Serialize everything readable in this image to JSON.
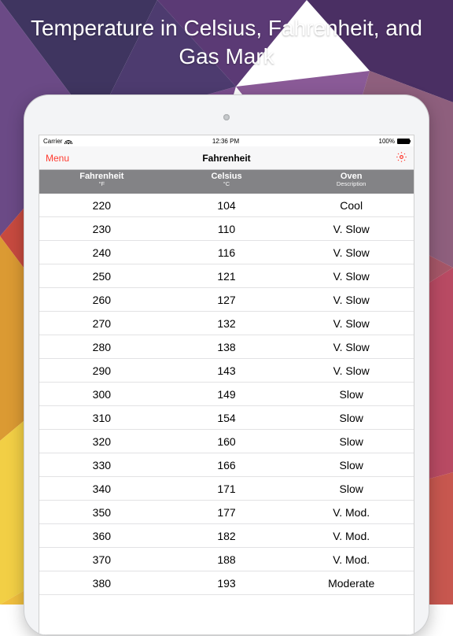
{
  "promo": {
    "title": "Temperature in Celsius, Fahrenheit, and Gas Mark"
  },
  "statusbar": {
    "carrier": "Carrier",
    "time": "12:36 PM",
    "battery": "100%"
  },
  "navbar": {
    "menu": "Menu",
    "title": "Fahrenheit",
    "settings_icon": "gear-icon"
  },
  "table": {
    "headers": [
      {
        "title": "Fahrenheit",
        "sub": "°F"
      },
      {
        "title": "Celsius",
        "sub": "°C"
      },
      {
        "title": "Oven",
        "sub": "Description"
      }
    ],
    "rows": [
      {
        "f": "220",
        "c": "104",
        "d": "Cool"
      },
      {
        "f": "230",
        "c": "110",
        "d": "V. Slow"
      },
      {
        "f": "240",
        "c": "116",
        "d": "V. Slow"
      },
      {
        "f": "250",
        "c": "121",
        "d": "V. Slow"
      },
      {
        "f": "260",
        "c": "127",
        "d": "V. Slow"
      },
      {
        "f": "270",
        "c": "132",
        "d": "V. Slow"
      },
      {
        "f": "280",
        "c": "138",
        "d": "V. Slow"
      },
      {
        "f": "290",
        "c": "143",
        "d": "V. Slow"
      },
      {
        "f": "300",
        "c": "149",
        "d": "Slow"
      },
      {
        "f": "310",
        "c": "154",
        "d": "Slow"
      },
      {
        "f": "320",
        "c": "160",
        "d": "Slow"
      },
      {
        "f": "330",
        "c": "166",
        "d": "Slow"
      },
      {
        "f": "340",
        "c": "171",
        "d": "Slow"
      },
      {
        "f": "350",
        "c": "177",
        "d": "V. Mod."
      },
      {
        "f": "360",
        "c": "182",
        "d": "V. Mod."
      },
      {
        "f": "370",
        "c": "188",
        "d": "V. Mod."
      },
      {
        "f": "380",
        "c": "193",
        "d": "Moderate"
      }
    ]
  }
}
